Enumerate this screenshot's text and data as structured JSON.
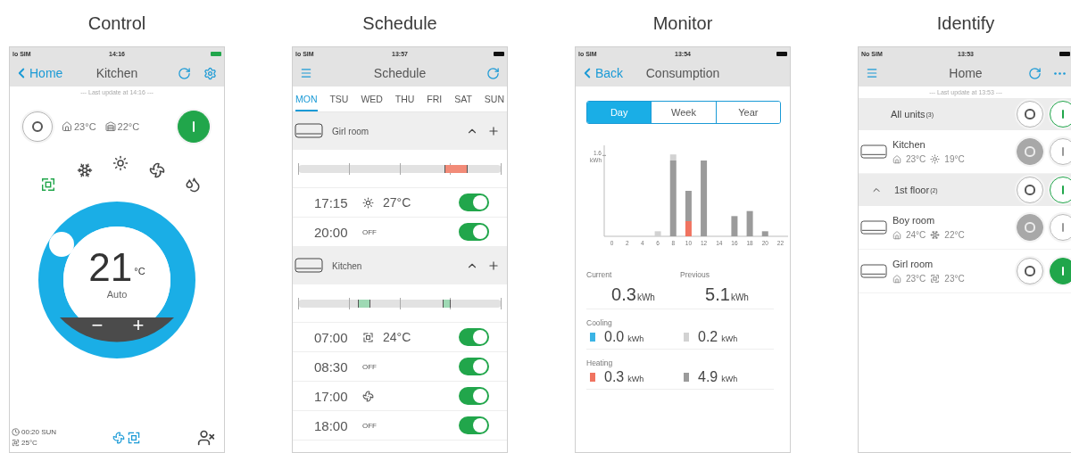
{
  "screens": [
    {
      "kind": "control",
      "caption": "Control",
      "status": {
        "carrier": "lo SIM",
        "time": "14:16"
      },
      "nav": {
        "back": "Home",
        "title": "Kitchen"
      },
      "last_update": "--- Last update at 14:16 ---",
      "indoor": "23°C",
      "outdoor": "22°C",
      "power_on": true,
      "modes": [
        {
          "kind": "auto",
          "selected": true
        },
        {
          "kind": "cool",
          "selected": false
        },
        {
          "kind": "heat",
          "selected": false
        },
        {
          "kind": "fan",
          "selected": false
        },
        {
          "kind": "dry",
          "selected": false
        }
      ],
      "dial": {
        "temperature": "21",
        "unit": "°C",
        "mode": "Auto",
        "minus": "−",
        "plus": "+"
      },
      "footer": {
        "timer": "00:20 SUN",
        "timer_setting": "25°C"
      }
    },
    {
      "kind": "schedule",
      "caption": "Schedule",
      "status": {
        "carrier": "lo SIM",
        "time": "13:57"
      },
      "nav": {
        "title": "Schedule"
      },
      "days": [
        {
          "label": "MON",
          "selected": true
        },
        {
          "label": "TSU",
          "selected": false
        },
        {
          "label": "WED",
          "selected": false
        },
        {
          "label": "THU",
          "selected": false
        },
        {
          "label": "FRI",
          "selected": false
        },
        {
          "label": "SAT",
          "selected": false
        },
        {
          "label": "SUN",
          "selected": false
        }
      ],
      "groups": [
        {
          "name": "Girl room",
          "expanded": true,
          "entries": [
            {
              "time": "17:15",
              "kind": "heat",
              "value": "27°C",
              "on": true
            },
            {
              "time": "20:00",
              "kind": "off",
              "value": "OFF",
              "on": true
            }
          ]
        },
        {
          "name": "Kitchen",
          "expanded": true,
          "entries": [
            {
              "time": "07:00",
              "kind": "auto",
              "value": "24°C",
              "on": true
            },
            {
              "time": "08:30",
              "kind": "off",
              "value": "OFF",
              "on": true
            },
            {
              "time": "17:00",
              "kind": "fan",
              "on": true
            },
            {
              "time": "18:00",
              "kind": "off",
              "value": "OFF",
              "on": true
            }
          ]
        }
      ]
    },
    {
      "kind": "monitor",
      "caption": "Monitor",
      "status": {
        "carrier": "lo SIM",
        "time": "13:54"
      },
      "nav": {
        "back": "Back",
        "title": "Consumption"
      },
      "periods": [
        {
          "label": "Day",
          "selected": true
        },
        {
          "label": "Week",
          "selected": false
        },
        {
          "label": "Year",
          "selected": false
        }
      ],
      "chart_data": {
        "type": "bar",
        "stacked": true,
        "categories": [
          "0",
          "2",
          "4",
          "6",
          "8",
          "10",
          "12",
          "14",
          "16",
          "18",
          "20",
          "22"
        ],
        "ylim": [
          0,
          1.8
        ],
        "yticks": [
          {
            "value": 1.6,
            "label": "1.6 kWh"
          }
        ],
        "series": [
          {
            "color": "#f07360",
            "values": [
              null,
              null,
              null,
              null,
              null,
              0.3,
              null,
              null,
              null,
              null,
              null,
              null
            ]
          },
          {
            "color": "#9b9b9b",
            "values": [
              null,
              null,
              null,
              null,
              1.5,
              0.6,
              1.5,
              null,
              0.4,
              0.5,
              0.1,
              null
            ]
          },
          {
            "color": "#d2d2d2",
            "values": [
              null,
              null,
              null,
              0.1,
              0.12,
              null,
              null,
              null,
              null,
              null,
              null,
              null
            ]
          }
        ]
      },
      "summary": {
        "current_label": "Current",
        "previous_label": "Previous",
        "current": {
          "value": "0.3",
          "unit": "kWh"
        },
        "previous": {
          "value": "5.1",
          "unit": "kWh"
        },
        "breakdown": [
          {
            "label": "Cooling",
            "items": [
              {
                "value": "0.0",
                "unit": "kWh",
                "color": "#3bb4e5"
              },
              {
                "value": "0.2",
                "unit": "kWh",
                "color": "#d2d2d2"
              }
            ]
          },
          {
            "label": "Heating",
            "items": [
              {
                "value": "0.3",
                "unit": "kWh",
                "color": "#f07360"
              },
              {
                "value": "4.9",
                "unit": "kWh",
                "color": "#9b9b9b"
              }
            ]
          }
        ]
      }
    },
    {
      "kind": "identify",
      "caption": "Identify",
      "status": {
        "carrier": "No SIM",
        "time": "13:53"
      },
      "nav": {
        "title": "Home"
      },
      "last_update": "--- Last update at 13:53 ---",
      "units": [
        {
          "kind": "group",
          "name": "All units",
          "count": "(3)"
        },
        {
          "kind": "unit",
          "name": "Kitchen",
          "indoor": "23°C",
          "mode": {
            "kind": "heat"
          },
          "set": "19°C",
          "on": false
        },
        {
          "kind": "group",
          "name": "1st floor",
          "count": "(2)",
          "expanded": true,
          "children": [
            {
              "kind": "unit",
              "name": "Boy room",
              "indoor": "24°C",
              "mode": {
                "kind": "cool"
              },
              "set": "22°C",
              "on": false
            },
            {
              "kind": "unit",
              "name": "Girl room",
              "indoor": "23°C",
              "mode": {
                "kind": "auto"
              },
              "set": "23°C",
              "on": true
            }
          ]
        }
      ]
    }
  ]
}
